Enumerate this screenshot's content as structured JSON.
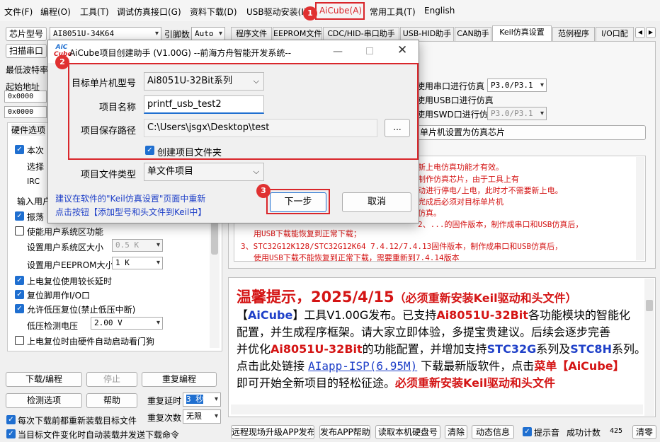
{
  "menu": [
    "文件(F)",
    "编程(O)",
    "工具(T)",
    "调试仿真接口(G)",
    "资料下载(D)",
    "USB驱动安装(I)",
    "AiCube(A)",
    "常用工具(T)",
    "English"
  ],
  "left": {
    "chip_label": "芯片型号",
    "chip_value": "AI8051U-34K64",
    "pin_label": "引脚数",
    "pin_value": "Auto",
    "scan_button": "扫描串口",
    "baud_label": "最低波特率",
    "start_addr_label": "起始地址",
    "addr1": "0x0000",
    "addr2": "0x0000",
    "hw_options_label": "硬件选项",
    "opt_truncated1": "本次",
    "opt_truncated2": "选择",
    "opt_truncated3": "IRC",
    "opt_truncated4": "输入用户",
    "opt_truncated5": "振荡",
    "enable_user_sys": "使能用户系统区功能",
    "set_user_sys_size": "设置用户系统区大小",
    "user_sys_size_value": "0.5 K",
    "set_user_eeprom": "设置用户EEPROM大小",
    "user_eeprom_value": "1   K",
    "poweron_delay": "上电复位使用较长延时",
    "reset_pin_io": "复位脚用作I/O口",
    "allow_lvr": "允许低压复位(禁止低压中断)",
    "lv_voltage_label": "低压检测电压",
    "lv_voltage_value": "2.00 V",
    "hw_watchdog": "上电复位时由硬件自动启动看门狗",
    "download_button": "下载/编程",
    "stop_button": "停止",
    "reprogram_button": "重复编程",
    "detect_button": "检测选项",
    "help_button": "帮助",
    "repeat_delay_label": "重复延时",
    "repeat_delay_value": "3 秒",
    "repeat_count_label": "重复次数",
    "repeat_count_value": "无限",
    "reload_each": "每次下载前都重新装载目标文件",
    "auto_reload": "当目标文件变化时自动装载并发送下载命令"
  },
  "tabs": [
    "程序文件",
    "EEPROM文件",
    "CDC/HID-串口助手",
    "USB-HID助手",
    "CAN助手",
    "Keil仿真设置",
    "范例程序",
    "I/O口配"
  ],
  "keil": {
    "use_uart": "使用串口进行仿真",
    "uart_value": "P3.0/P3.1",
    "use_usb": "使用USB口进行仿真",
    "use_swd": "使用SWD口进行仿真",
    "swd_value": "P3.0/P3.1",
    "set_chip_button": "单片机设置为仿真芯片",
    "notes": [
      "新上电仿真功能才有效。",
      "制作仿真芯片，由于工具上有",
      "动进行停电/上电，此时才不需要新上电。",
      "完成后必须对目标单片机",
      "仿真。",
      "2、...的固件版本，制作成串口和USB仿真后，",
      "用USB下载能恢复到正常下载；",
      "3、STC32G12K128/STC32G12K64  7.4.12/7.4.13固件版本，制作成串口和USB仿真后，",
      "使用USB下载不能恢复到正常下载，需要重新到7.4.14版本"
    ]
  },
  "tip": {
    "headline": "温馨提示，2025/4/15",
    "headline_sub": "（必须重新安装Keil驱动和头文件）",
    "l1_a": "【",
    "l1_b": "AiCube",
    "l1_c": "】工具V1.00G发布。已支持",
    "l1_d": "Ai8051U-32Bit",
    "l1_e": "各功能模块的智能化",
    "l2": "配置，并生成程序框架。请大家立即体验，多提宝贵建议。后续会逐步完善",
    "l3_a": "并优化",
    "l3_b": "Ai8051U-32Bit",
    "l3_c": "的功能配置，并增加支持",
    "l3_d": "STC32G",
    "l3_e": "系列及",
    "l3_f": "STC8H",
    "l3_g": "系列。",
    "l4_a": "点击此处链接 ",
    "l4_link": "AIapp-ISP(6.95M)",
    "l4_b": " 下载最新版软件，点击",
    "l4_c": "菜单【AiCube】",
    "l5_a": "即可开始全新项目的轻松征途。",
    "l5_b": "必须重新安装Keil驱动和头文件"
  },
  "bottom": {
    "remote_upgrade": "远程现场升级APP发布",
    "publish_help": "发布APP帮助",
    "read_disk": "读取本机硬盘号",
    "clear": "清除",
    "dynamic_info": "动态信息",
    "beep": "提示音",
    "success_count_label": "成功计数",
    "success_count_value": "425",
    "clear_zero": "清零"
  },
  "dialog": {
    "title": "AiCube项目创建助手 (V1.00G) --前海方舟智能开发系统--",
    "logo_top": "AiC",
    "logo_bottom": "Cube",
    "target_label": "目标单片机型号",
    "target_value": "Ai8051U-32Bit系列",
    "name_label": "项目名称",
    "name_value": "printf_usb_test2",
    "path_label": "项目保存路径",
    "path_value": "C:\\Users\\jsgx\\Desktop\\test",
    "browse_button": "...",
    "create_folder": "创建项目文件夹",
    "type_label": "项目文件类型",
    "type_value": "单文件项目",
    "hint_line1": "建议在软件的\"Keil仿真设置\"页面中重新",
    "hint_line2": "点击按钮【添加型号和头文件到Keil中】",
    "next_button": "下一步",
    "cancel_button": "取消"
  },
  "badges": [
    "1",
    "2",
    "3"
  ],
  "colors": {
    "accent_red": "#d9262b",
    "link_blue": "#1f40c8"
  }
}
